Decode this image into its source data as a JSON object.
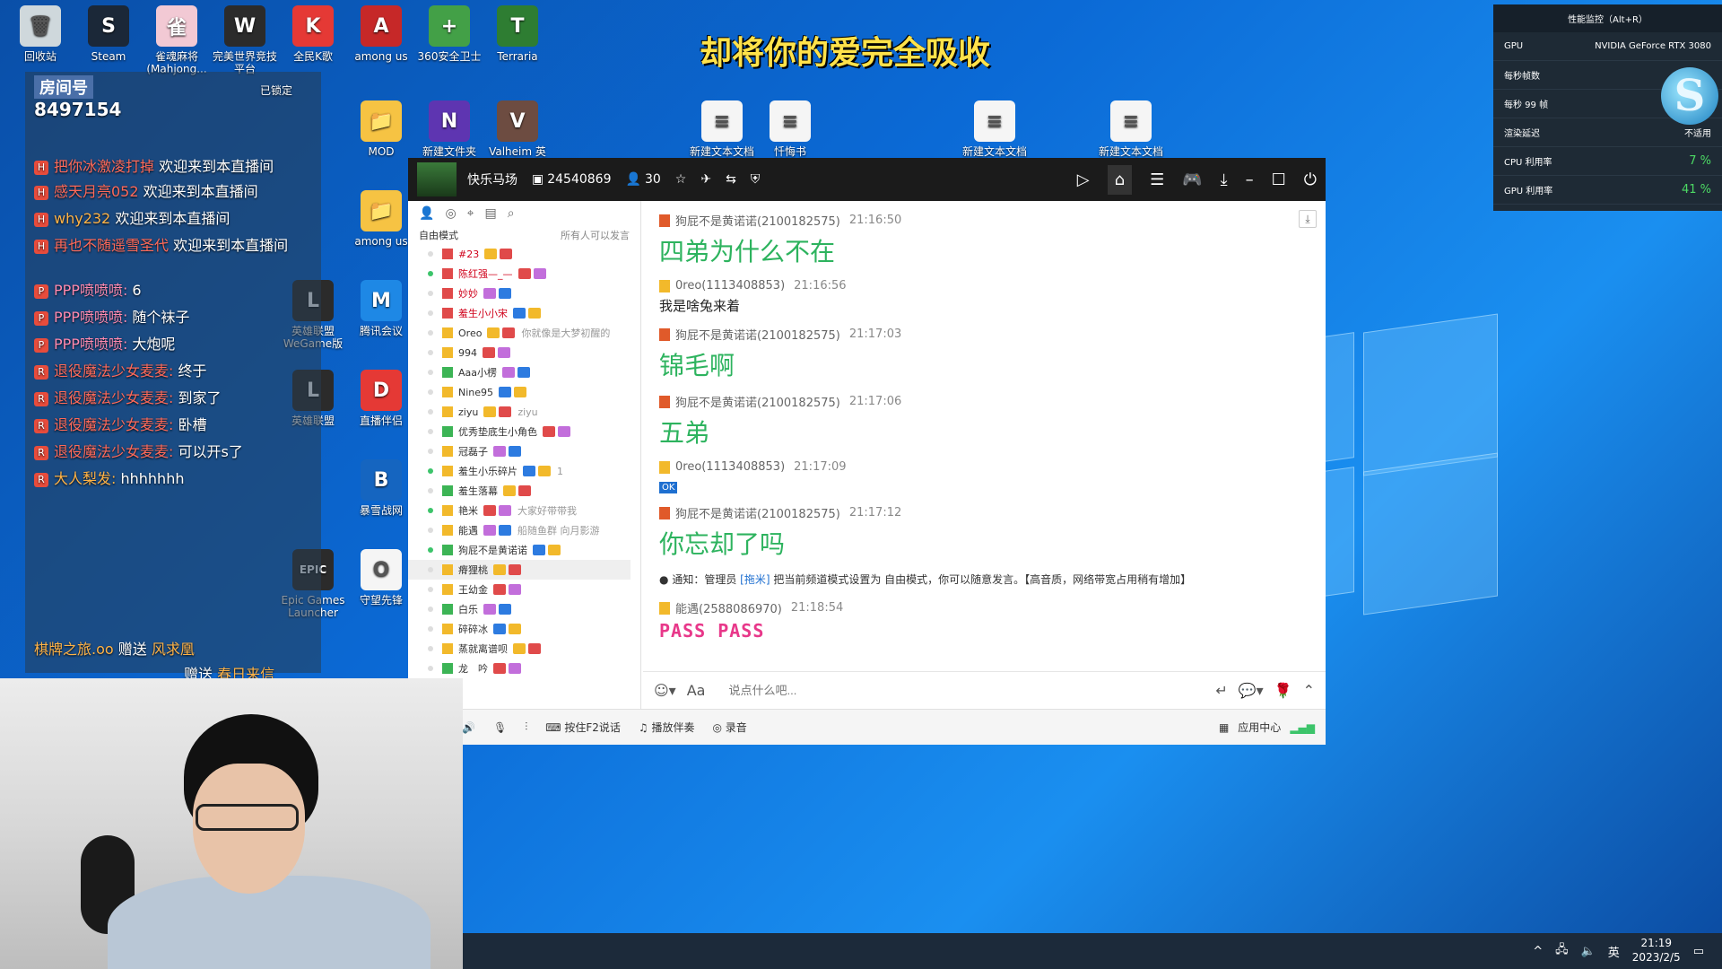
{
  "banner": "却将你的爱完全吸收",
  "desktop_icons": [
    {
      "label": "回收站",
      "color": "#cfd8dc",
      "glyph": "🗑"
    },
    {
      "label": "Steam",
      "color": "#1b2838",
      "glyph": "S"
    },
    {
      "label": "雀魂麻将(Mahjong...",
      "color": "#f2c9d4",
      "glyph": "雀"
    },
    {
      "label": "完美世界竞技平台",
      "color": "#2b2b2b",
      "glyph": "W"
    },
    {
      "label": "全民K歌",
      "color": "#e53935",
      "glyph": "K"
    },
    {
      "label": "among us",
      "color": "#c62828",
      "glyph": "A"
    },
    {
      "label": "360安全卫士",
      "color": "#43a047",
      "glyph": "+"
    },
    {
      "label": "Terraria",
      "color": "#2e7d32",
      "glyph": "T"
    },
    {
      "label": "MOD",
      "color": "#f6c343",
      "glyph": "📁"
    },
    {
      "label": "新建文件夹",
      "color": "#5e35b1",
      "glyph": "N"
    },
    {
      "label": "Valheim 英",
      "color": "#6d4c41",
      "glyph": "V"
    },
    {
      "label": "新建文本文档",
      "color": "#f5f5f5",
      "glyph": "≡"
    },
    {
      "label": "忏悔书",
      "color": "#f5f5f5",
      "glyph": "≡"
    },
    {
      "label": "新建文本文档",
      "color": "#f5f5f5",
      "glyph": "≡"
    },
    {
      "label": "新建文本文档",
      "color": "#f5f5f5",
      "glyph": "≡"
    },
    {
      "label": "among us",
      "color": "#f6c343",
      "glyph": "📁"
    },
    {
      "label": "腾讯会议",
      "color": "#1e88e5",
      "glyph": "M"
    },
    {
      "label": "直播伴侣",
      "color": "#e53935",
      "glyph": "D"
    },
    {
      "label": "暴雪战网",
      "color": "#1565c0",
      "glyph": "B"
    },
    {
      "label": "守望先锋",
      "color": "#f5f5f5",
      "glyph": "O"
    },
    {
      "label": "Epic Games Launcher",
      "color": "#2b2b2b",
      "glyph": "EPIC"
    },
    {
      "label": "英雄联盟WeGame版",
      "color": "#2b2b2b",
      "glyph": "L"
    },
    {
      "label": "英雄联盟",
      "color": "#2b2b2b",
      "glyph": "L"
    }
  ],
  "overlay": {
    "room_label": "房间号",
    "room_number": "8497154",
    "locked": "已锁定",
    "messages": [
      {
        "name": "把你冰激凌打掉",
        "text": "欢迎来到本直播间",
        "cls": "",
        "icon": "H"
      },
      {
        "name": "感天月亮052",
        "text": "欢迎来到本直播间",
        "cls": "",
        "icon": "H"
      },
      {
        "name": "why232",
        "text": "欢迎来到本直播间",
        "cls": "y",
        "icon": "H"
      },
      {
        "name": "再也不随遥雪圣代",
        "text": "欢迎来到本直播间",
        "cls": "",
        "icon": "H"
      },
      {
        "name": "PPP喷喷喷:",
        "text": "6",
        "cls": "p",
        "icon": "P"
      },
      {
        "name": "PPP喷喷喷:",
        "text": "随个袜子",
        "cls": "p",
        "icon": "P"
      },
      {
        "name": "PPP喷喷喷:",
        "text": "大炮呢",
        "cls": "p",
        "icon": "P"
      },
      {
        "name": "退役魔法少女麦麦:",
        "text": "终于",
        "cls": "",
        "icon": "R"
      },
      {
        "name": "退役魔法少女麦麦:",
        "text": "到家了",
        "cls": "",
        "icon": "R"
      },
      {
        "name": "退役魔法少女麦麦:",
        "text": "卧槽",
        "cls": "",
        "icon": "R"
      },
      {
        "name": "退役魔法少女麦麦:",
        "text": "可以开s了",
        "cls": "",
        "icon": "R"
      },
      {
        "name": "大人梨发:",
        "text": "hhhhhhh",
        "cls": "y",
        "icon": "R"
      }
    ],
    "gift_line": {
      "name": "棋牌之旅.oo",
      "action": "赠送",
      "gift": "风求凰"
    },
    "gift_line2": {
      "action": "赠送",
      "gift": "春日来信"
    }
  },
  "perf": {
    "title": "性能监控（Alt+R）",
    "rows": [
      {
        "k": "GPU",
        "v": "NVIDIA GeForce RTX 3080"
      },
      {
        "k": "每秒帧数",
        "v": ""
      },
      {
        "k": "每秒 99 帧",
        "v": ""
      },
      {
        "k": "渲染延迟",
        "v": "不适用"
      },
      {
        "k": "CPU 利用率",
        "v": "7 %"
      },
      {
        "k": "GPU 利用率",
        "v": "41 %"
      }
    ],
    "logo": "S"
  },
  "app": {
    "channel_name": "快乐马场",
    "channel_id": "24540869",
    "online_count": "30",
    "mode": "自由模式",
    "mode_note": "所有人可以发言",
    "users": [
      {
        "name": "#23",
        "red": true,
        "online": false,
        "sig": ""
      },
      {
        "name": "陈红强—_—",
        "red": true,
        "online": true,
        "sig": ""
      },
      {
        "name": "妙妙",
        "red": true,
        "online": false,
        "sig": ""
      },
      {
        "name": "羞生小小宋",
        "red": true,
        "online": false,
        "sig": ""
      },
      {
        "name": "Oreo",
        "red": false,
        "online": false,
        "sig": "你就像是大梦初醒的"
      },
      {
        "name": "994",
        "red": false,
        "online": false,
        "sig": ""
      },
      {
        "name": "Aaa小楞",
        "red": false,
        "online": false,
        "sig": ""
      },
      {
        "name": "Nine95",
        "red": false,
        "online": false,
        "sig": ""
      },
      {
        "name": "ziyu",
        "red": false,
        "online": false,
        "sig": "ziyu"
      },
      {
        "name": "优秀垫底生小角色",
        "red": false,
        "online": false,
        "sig": ""
      },
      {
        "name": "冠磊子",
        "red": false,
        "online": false,
        "sig": ""
      },
      {
        "name": "羞生小乐碎片",
        "red": false,
        "online": true,
        "sig": "1"
      },
      {
        "name": "羞生落幕",
        "red": false,
        "online": false,
        "sig": ""
      },
      {
        "name": "艳米",
        "red": false,
        "online": true,
        "sig": "大家好带带我"
      },
      {
        "name": "能遇",
        "red": false,
        "online": false,
        "sig": "船随鱼群 向月影游"
      },
      {
        "name": "狗屁不是黄诺诺",
        "red": false,
        "online": true,
        "sig": ""
      },
      {
        "name": "瘠狸桃",
        "red": false,
        "online": false,
        "sig": ""
      },
      {
        "name": "王幼金",
        "red": false,
        "online": false,
        "sig": ""
      },
      {
        "name": "白乐",
        "red": false,
        "online": false,
        "sig": ""
      },
      {
        "name": "碎碎冰",
        "red": false,
        "online": false,
        "sig": ""
      },
      {
        "name": "蒸就离谱呗",
        "red": false,
        "online": false,
        "sig": ""
      },
      {
        "name": "龙　吟",
        "red": false,
        "online": false,
        "sig": ""
      }
    ],
    "messages": [
      {
        "sender": "狗屁不是黄诺诺(2100182575)",
        "time": "21:16:50",
        "text": "四弟为什么不在",
        "style": "big",
        "role": "red"
      },
      {
        "sender": "0reo(1113408853)",
        "time": "21:16:56",
        "text": "我是啥兔来着",
        "style": "normal",
        "role": "gold"
      },
      {
        "sender": "狗屁不是黄诺诺(2100182575)",
        "time": "21:17:03",
        "text": "锦毛啊",
        "style": "big",
        "role": "red"
      },
      {
        "sender": "狗屁不是黄诺诺(2100182575)",
        "time": "21:17:06",
        "text": "五弟",
        "style": "big",
        "role": "red"
      },
      {
        "sender": "0reo(1113408853)",
        "time": "21:17:09",
        "text": "OK",
        "style": "emoji",
        "role": "gold"
      },
      {
        "sender": "狗屁不是黄诺诺(2100182575)",
        "time": "21:17:12",
        "text": "你忘却了吗",
        "style": "big",
        "role": "red"
      }
    ],
    "notice": {
      "prefix": "通知：管理员",
      "admin": "[拖米]",
      "text": "把当前频道模式设置为 自由模式，你可以随意发言。【高音质，网络带宽占用稍有增加】"
    },
    "last_message": {
      "sender": "能遇(2588086970)",
      "time": "21:18:54",
      "text": "PASS PASS"
    },
    "input_placeholder": "说点什么吧...",
    "bottom": {
      "ptt": "按住F2说话",
      "accompany": "播放伴奏",
      "record": "录音",
      "app_center": "应用中心"
    }
  },
  "taskbar": {
    "ime": "英",
    "time": "21:19",
    "date": "2023/2/5"
  }
}
